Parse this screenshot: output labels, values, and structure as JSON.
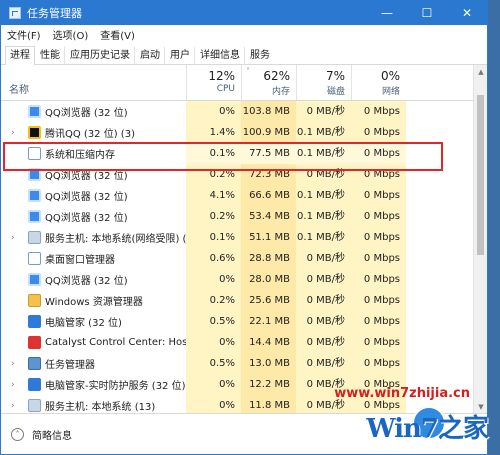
{
  "window": {
    "title": "任务管理器",
    "controls": {
      "minimize": "—",
      "maximize": "☐",
      "close": "✕"
    }
  },
  "menu": [
    "文件(F)",
    "选项(O)",
    "查看(V)"
  ],
  "tabs": [
    "进程",
    "性能",
    "应用历史记录",
    "启动",
    "用户",
    "详细信息",
    "服务"
  ],
  "columns": {
    "name": "名称",
    "cpu": {
      "pct": "12%",
      "label": "CPU"
    },
    "mem": {
      "pct": "62%",
      "label": "内存"
    },
    "disk": {
      "pct": "7%",
      "label": "磁盘"
    },
    "net": {
      "pct": "0%",
      "label": "网络"
    }
  },
  "rows": [
    {
      "name": "QQ浏览器 (32 位)",
      "cpu": "0%",
      "mem": "103.8 MB",
      "disk": "0 MB/秒",
      "net": "0 Mbps",
      "icon": "qq-browser-icon",
      "expand": ""
    },
    {
      "name": "腾讯QQ (32 位) (3)",
      "cpu": "1.4%",
      "mem": "100.9 MB",
      "disk": "0.1 MB/秒",
      "net": "0 Mbps",
      "icon": "tencent-qq-icon",
      "expand": "›"
    },
    {
      "name": "系统和压缩内存",
      "cpu": "0.1%",
      "mem": "77.5 MB",
      "disk": "0.1 MB/秒",
      "net": "0 Mbps",
      "icon": "system-icon",
      "expand": ""
    },
    {
      "name": "QQ浏览器 (32 位)",
      "cpu": "0.2%",
      "mem": "72.3 MB",
      "disk": "0 MB/秒",
      "net": "0 Mbps",
      "icon": "qq-browser-icon",
      "expand": ""
    },
    {
      "name": "QQ浏览器 (32 位)",
      "cpu": "4.1%",
      "mem": "66.6 MB",
      "disk": "0.1 MB/秒",
      "net": "0 Mbps",
      "icon": "qq-browser-icon",
      "expand": ""
    },
    {
      "name": "QQ浏览器 (32 位)",
      "cpu": "0.2%",
      "mem": "53.4 MB",
      "disk": "0.1 MB/秒",
      "net": "0 Mbps",
      "icon": "qq-browser-icon",
      "expand": ""
    },
    {
      "name": "服务主机: 本地系统(网络受限) (...",
      "cpu": "0.1%",
      "mem": "51.1 MB",
      "disk": "0.1 MB/秒",
      "net": "0 Mbps",
      "icon": "service-host-icon",
      "expand": "›"
    },
    {
      "name": "桌面窗口管理器",
      "cpu": "0.6%",
      "mem": "28.8 MB",
      "disk": "0 MB/秒",
      "net": "0 Mbps",
      "icon": "desktop-window-icon",
      "expand": ""
    },
    {
      "name": "QQ浏览器 (32 位)",
      "cpu": "0%",
      "mem": "28.0 MB",
      "disk": "0 MB/秒",
      "net": "0 Mbps",
      "icon": "qq-browser-icon",
      "expand": ""
    },
    {
      "name": "Windows 资源管理器",
      "cpu": "0.2%",
      "mem": "25.6 MB",
      "disk": "0 MB/秒",
      "net": "0 Mbps",
      "icon": "explorer-icon",
      "expand": ""
    },
    {
      "name": "电脑管家 (32 位)",
      "cpu": "0.5%",
      "mem": "22.1 MB",
      "disk": "0 MB/秒",
      "net": "0 Mbps",
      "icon": "pc-manager-icon",
      "expand": ""
    },
    {
      "name": "Catalyst Control Center: Host...",
      "cpu": "0%",
      "mem": "14.4 MB",
      "disk": "0 MB/秒",
      "net": "0 Mbps",
      "icon": "catalyst-icon",
      "expand": ""
    },
    {
      "name": "任务管理器",
      "cpu": "0.5%",
      "mem": "13.0 MB",
      "disk": "0 MB/秒",
      "net": "0 Mbps",
      "icon": "task-manager-icon",
      "expand": "›"
    },
    {
      "name": "电脑管家-实时防护服务 (32 位)",
      "cpu": "0%",
      "mem": "12.2 MB",
      "disk": "0 MB/秒",
      "net": "0 Mbps",
      "icon": "pc-manager-shield-icon",
      "expand": "›"
    },
    {
      "name": "服务主机: 本地系统 (13)",
      "cpu": "0%",
      "mem": "11.8 MB",
      "disk": "0 MB/秒",
      "net": "0 Mbps",
      "icon": "service-host-icon",
      "expand": "›"
    }
  ],
  "footer": {
    "label": "简略信息"
  },
  "watermark": {
    "url": "www.win7zhijia.cn",
    "logo": "Win7之家"
  },
  "colors": {
    "title_bar": "#2b78d0",
    "highlight_box": "#e2262e",
    "cpu_bg": "#fff4c4",
    "mem_bg": "#ffe9a8"
  }
}
